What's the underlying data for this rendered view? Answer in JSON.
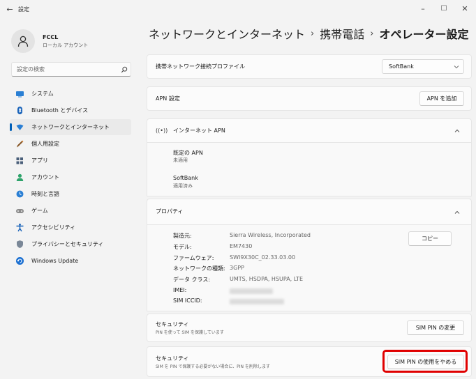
{
  "window": {
    "title": "設定",
    "back_glyph": "←",
    "minimize_glyph": "–",
    "maximize_glyph": "☐",
    "close_glyph": "✕"
  },
  "profile": {
    "name": "FCCL",
    "account_type": "ローカル アカウント",
    "icon": "person-icon"
  },
  "search": {
    "placeholder": "設定の検索",
    "icon": "search-icon"
  },
  "sidebar": {
    "items": [
      {
        "label": "システム",
        "icon": "monitor-icon",
        "active": false
      },
      {
        "label": "Bluetooth とデバイス",
        "icon": "bluetooth-icon",
        "active": false
      },
      {
        "label": "ネットワークとインターネット",
        "icon": "wifi-icon",
        "active": true
      },
      {
        "label": "個人用設定",
        "icon": "pen-icon",
        "active": false
      },
      {
        "label": "アプリ",
        "icon": "apps-icon",
        "active": false
      },
      {
        "label": "アカウント",
        "icon": "account-icon",
        "active": false
      },
      {
        "label": "時刻と言語",
        "icon": "globe-clock-icon",
        "active": false
      },
      {
        "label": "ゲーム",
        "icon": "gamepad-icon",
        "active": false
      },
      {
        "label": "アクセシビリティ",
        "icon": "accessibility-icon",
        "active": false
      },
      {
        "label": "プライバシーとセキュリティ",
        "icon": "shield-icon",
        "active": false
      },
      {
        "label": "Windows Update",
        "icon": "update-icon",
        "active": false
      }
    ]
  },
  "breadcrumb": {
    "part1": "ネットワークとインターネット",
    "part2": "携帯電話",
    "current": "オペレーター設定",
    "separator": "›"
  },
  "network_profile": {
    "label": "携帯ネットワーク接続プロファイル",
    "selected": "SoftBank"
  },
  "apn_settings": {
    "label": "APN 設定",
    "add_button": "APN を追加"
  },
  "internet_apn": {
    "label": "インターネット APN",
    "entries": [
      {
        "name": "既定の APN",
        "status": "未適用"
      },
      {
        "name": "SoftBank",
        "status": "適用済み"
      }
    ]
  },
  "properties": {
    "label": "プロパティ",
    "copy_button": "コピー",
    "rows": [
      {
        "label": "製造元:",
        "value": "Sierra Wireless, Incorporated"
      },
      {
        "label": "モデル:",
        "value": "EM7430"
      },
      {
        "label": "ファームウェア:",
        "value": "SWI9X30C_02.33.03.00"
      },
      {
        "label": "ネットワークの種類:",
        "value": "3GPP"
      },
      {
        "label": "データ クラス:",
        "value": "UMTS, HSDPA, HSUPA, LTE"
      },
      {
        "label": "IMEI:",
        "value": ""
      },
      {
        "label": "SIM ICCID:",
        "value": ""
      }
    ]
  },
  "security1": {
    "title": "セキュリティ",
    "subtitle": "PIN を使って SIM を保護しています",
    "button": "SIM PIN の変更"
  },
  "security2": {
    "title": "セキュリティ",
    "subtitle": "SIM を PIN で保護する必要がない場合に、PIN を削除します",
    "button": "SIM PIN の使用をやめる"
  },
  "colors": {
    "accent": "#005fb8",
    "highlight": "#e00000"
  }
}
